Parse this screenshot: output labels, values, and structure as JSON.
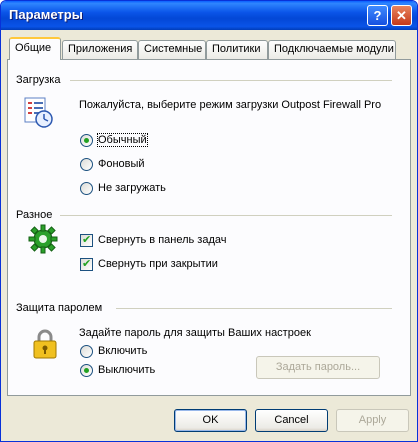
{
  "window": {
    "title": "Параметры",
    "help_glyph": "?",
    "close_glyph": "✕"
  },
  "tabs": [
    {
      "label": "Общие",
      "active": true
    },
    {
      "label": "Приложения",
      "active": false
    },
    {
      "label": "Системные",
      "active": false
    },
    {
      "label": "Политики",
      "active": false
    },
    {
      "label": "Подключаемые модули",
      "active": false
    }
  ],
  "loading": {
    "group_title": "Загрузка",
    "description": "Пожалуйста, выберите режим загрузки Outpost Firewall Pro",
    "options": [
      {
        "label": "Обычный",
        "checked": true
      },
      {
        "label": "Фоновый",
        "checked": false
      },
      {
        "label": "Не загружать",
        "checked": false
      }
    ]
  },
  "misc": {
    "group_title": "Разное",
    "options": [
      {
        "label": "Свернуть в панель задач",
        "checked": true
      },
      {
        "label": "Свернуть при закрытии",
        "checked": true
      }
    ]
  },
  "password": {
    "group_title": "Защита паролем",
    "description": "Задайте пароль для защиты Ваших настроек",
    "options": [
      {
        "label": "Включить",
        "checked": false
      },
      {
        "label": "Выключить",
        "checked": true
      }
    ],
    "set_button": "Задать пароль..."
  },
  "footer": {
    "ok": "OK",
    "cancel": "Cancel",
    "apply": "Apply"
  }
}
